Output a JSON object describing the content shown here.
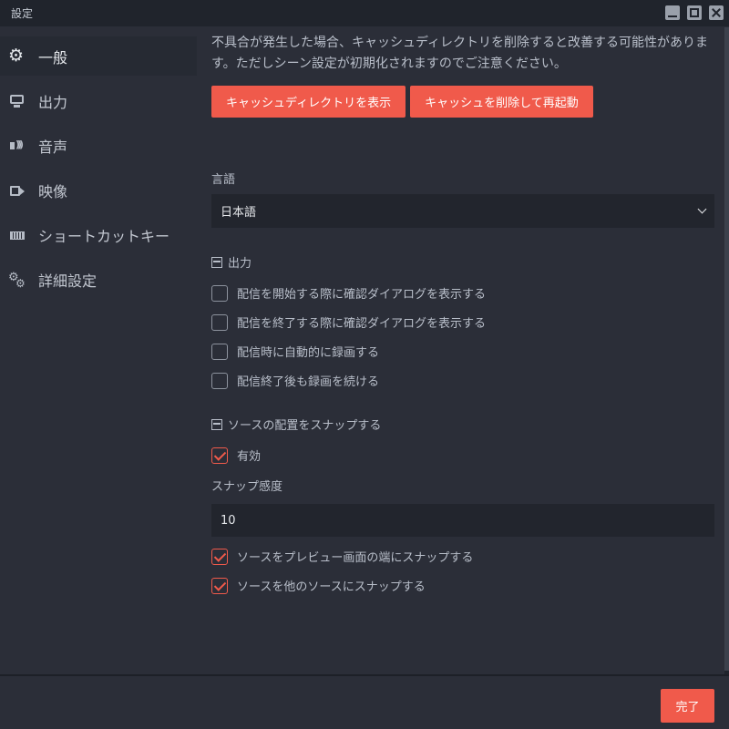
{
  "window": {
    "title": "設定"
  },
  "sidebar": {
    "items": [
      {
        "label": "一般",
        "icon": "gear-icon",
        "active": true
      },
      {
        "label": "出力",
        "icon": "monitor-icon"
      },
      {
        "label": "音声",
        "icon": "speaker-icon"
      },
      {
        "label": "映像",
        "icon": "camera-icon"
      },
      {
        "label": "ショートカットキー",
        "icon": "keyboard-icon"
      },
      {
        "label": "詳細設定",
        "icon": "gears-icon"
      }
    ]
  },
  "main": {
    "cache_warning": "不具合が発生した場合、キャッシュディレクトリを削除すると改善する可能性があります。ただしシーン設定が初期化されますのでご注意ください。",
    "show_cache_button": "キャッシュディレクトリを表示",
    "clear_cache_button": "キャッシュを削除して再起動",
    "language_label": "言語",
    "language_value": "日本語",
    "output_section": {
      "title": "出力",
      "options": [
        {
          "label": "配信を開始する際に確認ダイアログを表示する",
          "checked": false
        },
        {
          "label": "配信を終了する際に確認ダイアログを表示する",
          "checked": false
        },
        {
          "label": "配信時に自動的に録画する",
          "checked": false
        },
        {
          "label": "配信終了後も録画を続ける",
          "checked": false
        }
      ]
    },
    "snap_section": {
      "title": "ソースの配置をスナップする",
      "enabled_label": "有効",
      "enabled": true,
      "sensitivity_label": "スナップ感度",
      "sensitivity_value": "10",
      "options": [
        {
          "label": "ソースをプレビュー画面の端にスナップする",
          "checked": true
        },
        {
          "label": "ソースを他のソースにスナップする",
          "checked": true
        }
      ]
    }
  },
  "footer": {
    "done_button": "完了"
  },
  "colors": {
    "accent": "#f05a4b",
    "background": "#2b2e38",
    "titlebar": "#20242c",
    "input": "#22252d"
  }
}
